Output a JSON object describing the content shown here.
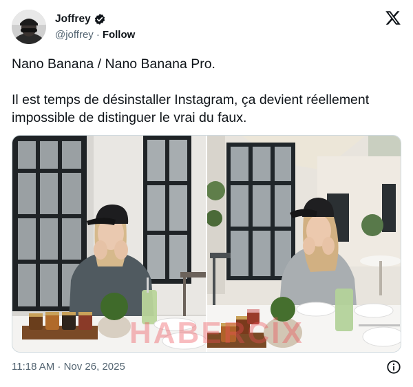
{
  "author": {
    "name": "Joffrey",
    "handle": "@joffrey",
    "separator": "·",
    "follow_label": "Follow",
    "verified": true
  },
  "platform_icon": "x-logo-icon",
  "tweet": {
    "line1": "Nano Banana / Nano Banana Pro.",
    "line2": "Il est temps de désinstaller Instagram, ça devient réellement impossible de distinguer le vrai du faux."
  },
  "media": {
    "watermark": "HABERCİX",
    "photos": [
      {
        "subject": "woman in black cap at cafe table with jars and green drink"
      },
      {
        "subject": "woman in black cap at courtyard cafe table with jars and green drink"
      }
    ]
  },
  "footer": {
    "timestamp": "11:18 AM · Nov 26, 2025",
    "info_icon": "info-icon"
  },
  "colors": {
    "text": "#0f1419",
    "secondary": "#536471",
    "verified_badge": "#0f1419",
    "watermark": "#ec5056"
  }
}
